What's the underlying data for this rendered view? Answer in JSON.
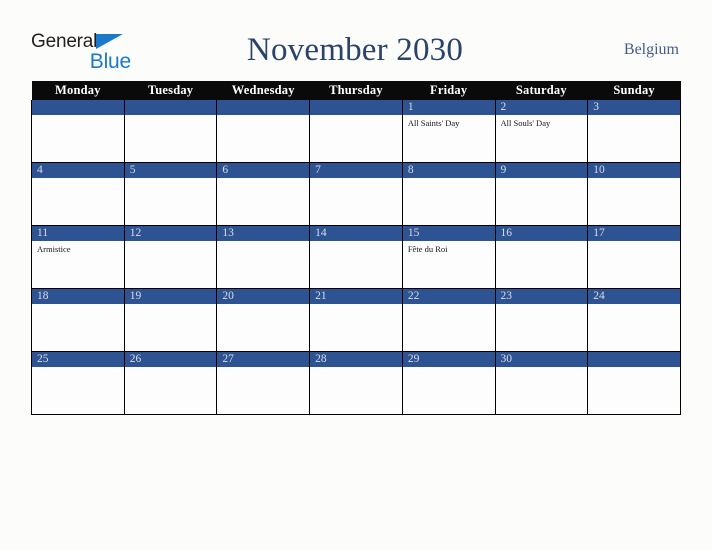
{
  "brand": {
    "name_part1": "General",
    "name_part2": "Blue",
    "triangle_icon": "triangle-icon",
    "color_black": "#231f20",
    "color_blue": "#1a79c8"
  },
  "header": {
    "title": "November 2030",
    "country": "Belgium"
  },
  "colors": {
    "accent_blue": "#2e5392",
    "header_black": "#0a0a0a",
    "title_navy": "#2b4369",
    "country_navy": "#445d86",
    "page_background": "#fcfcfa"
  },
  "weekdays": [
    "Monday",
    "Tuesday",
    "Wednesday",
    "Thursday",
    "Friday",
    "Saturday",
    "Sunday"
  ],
  "weeks": [
    [
      {
        "day": "",
        "events": []
      },
      {
        "day": "",
        "events": []
      },
      {
        "day": "",
        "events": []
      },
      {
        "day": "",
        "events": []
      },
      {
        "day": "1",
        "events": [
          "All Saints' Day"
        ]
      },
      {
        "day": "2",
        "events": [
          "All Souls' Day"
        ]
      },
      {
        "day": "3",
        "events": []
      }
    ],
    [
      {
        "day": "4",
        "events": []
      },
      {
        "day": "5",
        "events": []
      },
      {
        "day": "6",
        "events": []
      },
      {
        "day": "7",
        "events": []
      },
      {
        "day": "8",
        "events": []
      },
      {
        "day": "9",
        "events": []
      },
      {
        "day": "10",
        "events": []
      }
    ],
    [
      {
        "day": "11",
        "events": [
          "Armistice"
        ]
      },
      {
        "day": "12",
        "events": []
      },
      {
        "day": "13",
        "events": []
      },
      {
        "day": "14",
        "events": []
      },
      {
        "day": "15",
        "events": [
          "Fête du Roi"
        ]
      },
      {
        "day": "16",
        "events": []
      },
      {
        "day": "17",
        "events": []
      }
    ],
    [
      {
        "day": "18",
        "events": []
      },
      {
        "day": "19",
        "events": []
      },
      {
        "day": "20",
        "events": []
      },
      {
        "day": "21",
        "events": []
      },
      {
        "day": "22",
        "events": []
      },
      {
        "day": "23",
        "events": []
      },
      {
        "day": "24",
        "events": []
      }
    ],
    [
      {
        "day": "25",
        "events": []
      },
      {
        "day": "26",
        "events": []
      },
      {
        "day": "27",
        "events": []
      },
      {
        "day": "28",
        "events": []
      },
      {
        "day": "29",
        "events": []
      },
      {
        "day": "30",
        "events": []
      },
      {
        "day": "",
        "events": []
      }
    ]
  ]
}
